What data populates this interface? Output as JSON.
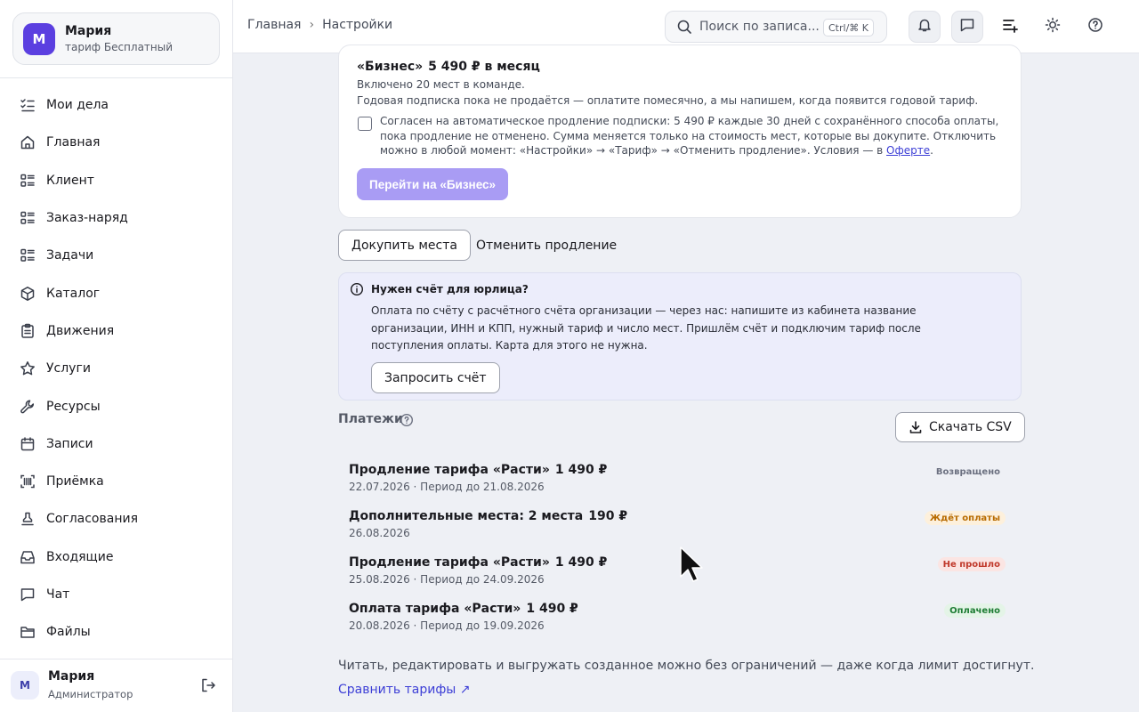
{
  "account": {
    "avatar_letter": "М",
    "name": "Мария",
    "plan": "тариф Бесплатный"
  },
  "nav": [
    {
      "label": "Мои дела",
      "icon": "checklist-icon"
    },
    {
      "label": "Главная",
      "icon": "home-icon"
    },
    {
      "label": "Клиент",
      "icon": "list-icon"
    },
    {
      "label": "Заказ-наряд",
      "icon": "list-icon"
    },
    {
      "label": "Задачи",
      "icon": "list-icon"
    },
    {
      "label": "Каталог",
      "icon": "box-icon"
    },
    {
      "label": "Движения",
      "icon": "clipboard-icon"
    },
    {
      "label": "Услуги",
      "icon": "star-icon"
    },
    {
      "label": "Ресурсы",
      "icon": "wrench-icon"
    },
    {
      "label": "Записи",
      "icon": "calendar-icon"
    },
    {
      "label": "Приёмка",
      "icon": "scan-icon"
    },
    {
      "label": "Согласования",
      "icon": "stamp-icon"
    },
    {
      "label": "Входящие",
      "icon": "inbox-icon"
    },
    {
      "label": "Чат",
      "icon": "chat-icon"
    },
    {
      "label": "Файлы",
      "icon": "folder-icon"
    }
  ],
  "user": {
    "avatar_letter": "М",
    "name": "Мария",
    "role": "Администратор"
  },
  "header": {
    "breadcrumb": [
      "Главная",
      "Настройки"
    ],
    "search_placeholder": "Поиск по записа...",
    "search_shortcut": "Ctrl/⌘ K"
  },
  "plan_card": {
    "plan_name": "«Бизнес»",
    "plan_price": "5 490 ₽ в месяц",
    "seats_text": "Включено 20 мест в команде.",
    "annual_text": "Годовая подписка пока не продаётся — оплатите помесячно, а мы напишем, когда появится годовой тариф.",
    "agree_text": "Согласен на автоматическое продление подписки: 5 490 ₽ каждые 30 дней с сохранённого способа оплаты, пока продление не отменено. Сумма меняется только на стоимость мест, которые вы докупите. Отключить можно в любой момент: «Настройки» → «Тариф» → «Отменить продление». Условия — в",
    "agree_link": "Оферте",
    "agree_end": ".",
    "agree_checked": false,
    "upgrade_button": "Перейти на «Бизнес»"
  },
  "actions": {
    "buy_seats": "Докупить места",
    "cancel_renewal": "Отменить продление"
  },
  "invoice_notice": {
    "title": "Нужен счёт для юрлица?",
    "body": "Оплата по счёту с расчётного счёта организации — через нас: напишите из кабинета название организации, ИНН и КПП, нужный тариф и число мест. Пришлём счёт и подключим тариф после поступления оплаты. Карта для этого не нужна.",
    "button": "Запросить счёт"
  },
  "payments": {
    "title": "Платежи",
    "csv_button": "Скачать CSV",
    "rows": [
      {
        "title": "Продление тарифа «Расти»",
        "amount": "1 490 ₽",
        "date": "22.07.2026",
        "period": "· Период до 21.08.2026",
        "status": "Возвращено",
        "status_color": "#6b7080"
      },
      {
        "title": "Дополнительные места: 2 места",
        "amount": "190 ₽",
        "date": "26.08.2026",
        "period": "",
        "status": "Ждёт оплаты",
        "status_color": "#b86b00"
      },
      {
        "title": "Продление тарифа «Расти»",
        "amount": "1 490 ₽",
        "date": "25.08.2026",
        "period": "· Период до 24.09.2026",
        "status": "Не прошло",
        "status_color": "#c0392b"
      },
      {
        "title": "Оплата тарифа «Расти»",
        "amount": "1 490 ₽",
        "date": "20.08.2026",
        "period": "· Период до 19.09.2026",
        "status": "Оплачено",
        "status_color": "#1e7d34"
      }
    ]
  },
  "footnote": "Читать, редактировать и выгружать созданное можно без ограничений — даже когда лимит достигнут.",
  "compare_link": "Сравнить тарифы ↗",
  "colors": {
    "accent": "#5b3fe0",
    "upgrade_button_disabled": "#a99cf4",
    "notice_bg": "#ecedfb",
    "link": "#3d3fd6"
  }
}
